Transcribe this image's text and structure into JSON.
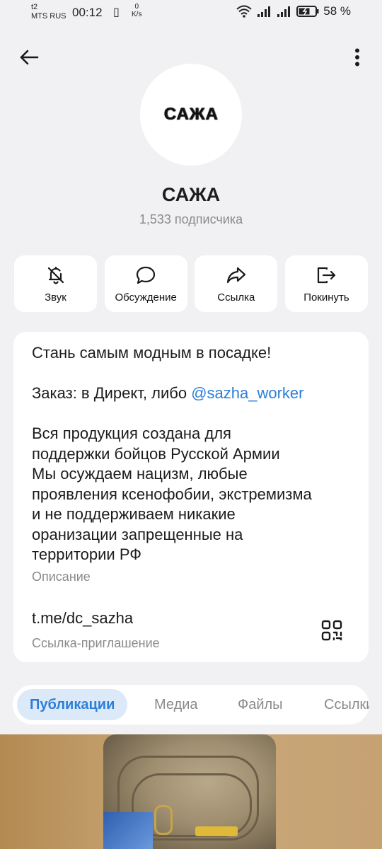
{
  "status_bar": {
    "carrier_top": "t2",
    "carrier_bottom": "MTS RUS",
    "time": "00:12",
    "speed_value": "0",
    "speed_unit": "K/s",
    "battery_percent": "58 %"
  },
  "channel": {
    "avatar_text": "САЖА",
    "name": "САЖА",
    "subscribers": "1,533 подписчика"
  },
  "actions": [
    {
      "label": "Звук",
      "icon": "bell-off-icon"
    },
    {
      "label": "Обсуждение",
      "icon": "chat-bubble-icon"
    },
    {
      "label": "Ссылка",
      "icon": "share-arrow-icon"
    },
    {
      "label": "Покинуть",
      "icon": "leave-icon"
    }
  ],
  "info": {
    "description_line1": "Стань самым модным в посадке!",
    "description_order_prefix": "Заказ: в Директ, либо ",
    "description_mention": "@sazha_worker",
    "description_body": "Вся продукция создана для\nподдержки бойцов Русской Армии\nМы осуждаем нацизм, любые\nпроявления ксенофобии, экстремизма\nи не поддерживаем никакие\nоранизации запрещенные на\nтерритории РФ",
    "description_label": "Описание",
    "invite_link": "t.me/dc_sazha",
    "invite_label": "Ссылка-приглашение"
  },
  "tabs": [
    {
      "label": "Публикации",
      "active": true
    },
    {
      "label": "Медиа",
      "active": false
    },
    {
      "label": "Файлы",
      "active": false
    },
    {
      "label": "Ссылки",
      "active": false
    }
  ],
  "colors": {
    "accent": "#2b7fd8",
    "background": "#f1f1f3",
    "card": "#ffffff",
    "secondary_text": "#8a8a8e"
  }
}
